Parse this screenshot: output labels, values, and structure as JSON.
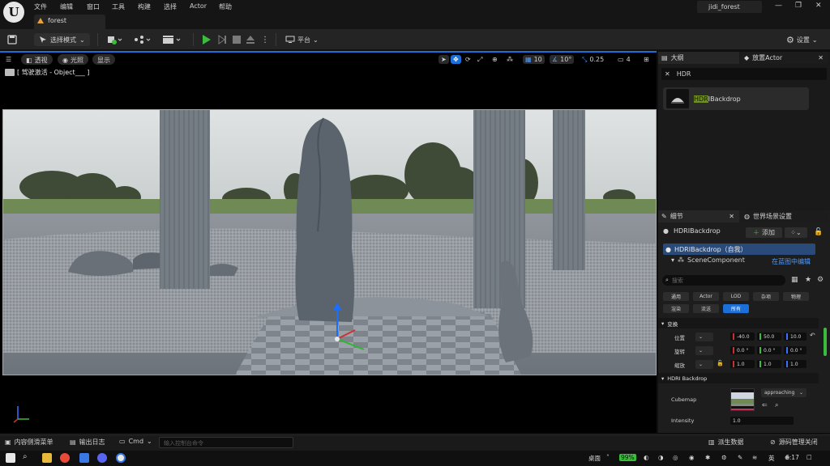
{
  "window": {
    "menu": [
      "文件",
      "编辑",
      "窗口",
      "工具",
      "构建",
      "选择",
      "Actor",
      "帮助"
    ],
    "project_name": "jidi_forest",
    "level_tab": "forest"
  },
  "toolbar": {
    "select_mode": "选择模式",
    "platform": "平台",
    "settings": "设置"
  },
  "viewport": {
    "perspective": "透视",
    "lighting": "光照",
    "show": "显示",
    "pilot_label": "[ 驾驶激活 - Object___ ]",
    "grid_snap": "10",
    "rotate_snap": "10°",
    "scale_snap": "0.25",
    "camera_speed": "4"
  },
  "outliner": {
    "tab": "大纲",
    "place_tab": "放置Actor",
    "search_value": "HDR",
    "result_highlight": "HDR",
    "result_rest": "IBackdrop"
  },
  "details": {
    "tab": "细节",
    "world_tab": "世界场景设置",
    "actor_name": "HDRIBackdrop",
    "add_label": "添加",
    "self_item": "HDRIBackdrop（自我）",
    "component": "SceneComponent",
    "edit_in_bp": "在蓝图中编辑",
    "search_placeholder": "搜索",
    "filters": [
      "通用",
      "Actor",
      "LOD",
      "杂项",
      "物理",
      "渲染",
      "流送",
      "所有"
    ],
    "transform_section": "变换",
    "location": {
      "label": "位置",
      "x": "-40.0",
      "y": "50.0",
      "z": "10.0"
    },
    "rotation": {
      "label": "旋转",
      "x": "0.0 °",
      "y": "0.0 °",
      "z": "0.0 °"
    },
    "scale": {
      "label": "缩放",
      "x": "1.0",
      "y": "1.0",
      "z": "1.0"
    },
    "hdri_section": "HDRI Backdrop",
    "cubemap_label": "Cubemap",
    "cubemap_value": "approaching",
    "intensity_label": "Intensity",
    "intensity_value": "1.0"
  },
  "bottom": {
    "content_drawer": "内容侧滑菜单",
    "output_log": "输出日志",
    "cmd": "Cmd",
    "cmd_placeholder": "输入控制台命令",
    "derived_data": "派生数据",
    "source_control": "源码管理关闭"
  },
  "taskbar": {
    "desktop": "桌面",
    "battery": "99%",
    "ime": "英",
    "time": "6:17"
  },
  "colors": {
    "accent_blue": "#1a6fd8",
    "selection_outline": "#d9a52c",
    "play_green": "#3cbc3c"
  }
}
